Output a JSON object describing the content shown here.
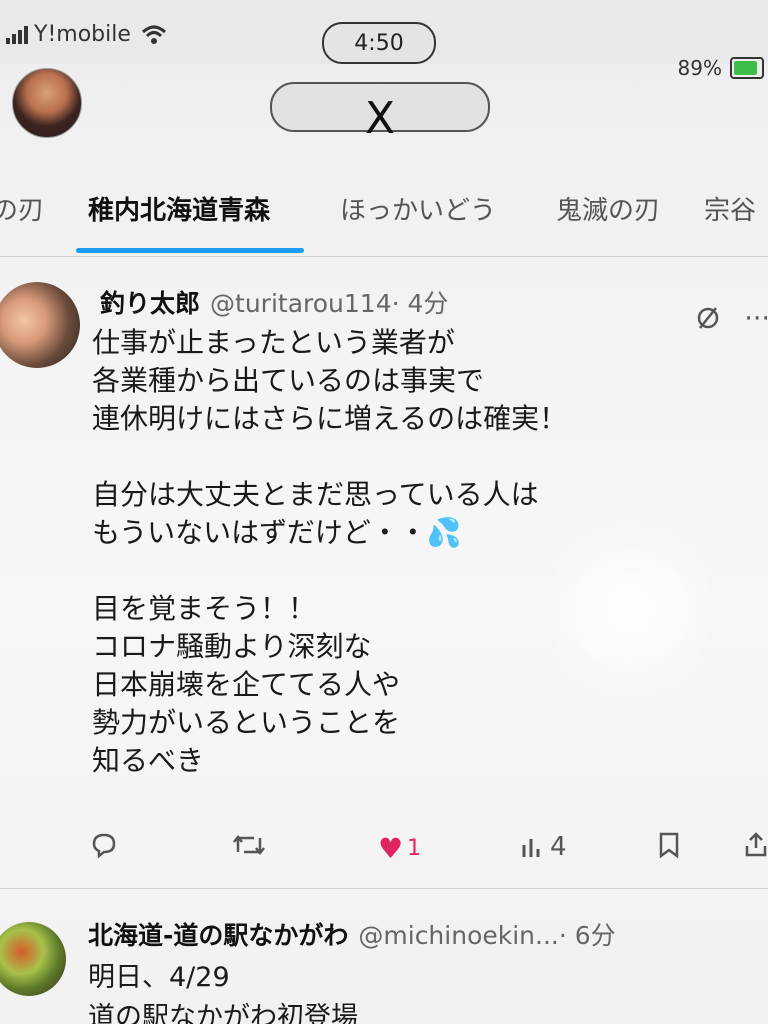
{
  "status_bar": {
    "carrier": "Y!mobile",
    "time": "4:50",
    "battery": "89%"
  },
  "header": {
    "logo": "X",
    "avatar_icon": "profile-avatar"
  },
  "tabs": [
    {
      "label": "の刃",
      "active": false
    },
    {
      "label": "稚内北海道青森",
      "active": true
    },
    {
      "label": "ほっかいどう",
      "active": false
    },
    {
      "label": "鬼滅の刃",
      "active": false
    },
    {
      "label": "宗谷",
      "active": false
    }
  ],
  "tweet": {
    "name": "釣り太郎",
    "handle": "@turitarou114",
    "time": "· 4分",
    "lines": [
      "仕事が止まったという業者が",
      "各業種から出ているのは事実で",
      " 連休明けにはさらに増えるのは確実！",
      "",
      "自分は大丈夫とまだ思っている人は",
      "もういないはずだけど・・💦",
      "",
      "目を覚まそう！！",
      "コロナ騒動より深刻な",
      "日本崩壊を企ててる人や",
      "勢力がいるということを",
      "知るべき"
    ],
    "actions": {
      "reply_icon": "reply-icon",
      "retweet_icon": "retweet-icon",
      "like_icon": "heart-icon",
      "like_count": "1",
      "views_icon": "views-icon",
      "views_count": "4",
      "bookmark_icon": "bookmark-icon",
      "share_icon": "share-icon"
    },
    "grok_icon": "grok-icon",
    "more_icon": "more-icon"
  },
  "tweet2": {
    "name": "北海道-道の駅なかがわ",
    "handle": "@michinoekin...",
    "time": "· 6分",
    "lines": [
      "明日、4/29",
      "道の駅なかがわ初登場"
    ]
  },
  "colors": {
    "accent": "#1d9bf0",
    "like": "#e0245e"
  }
}
